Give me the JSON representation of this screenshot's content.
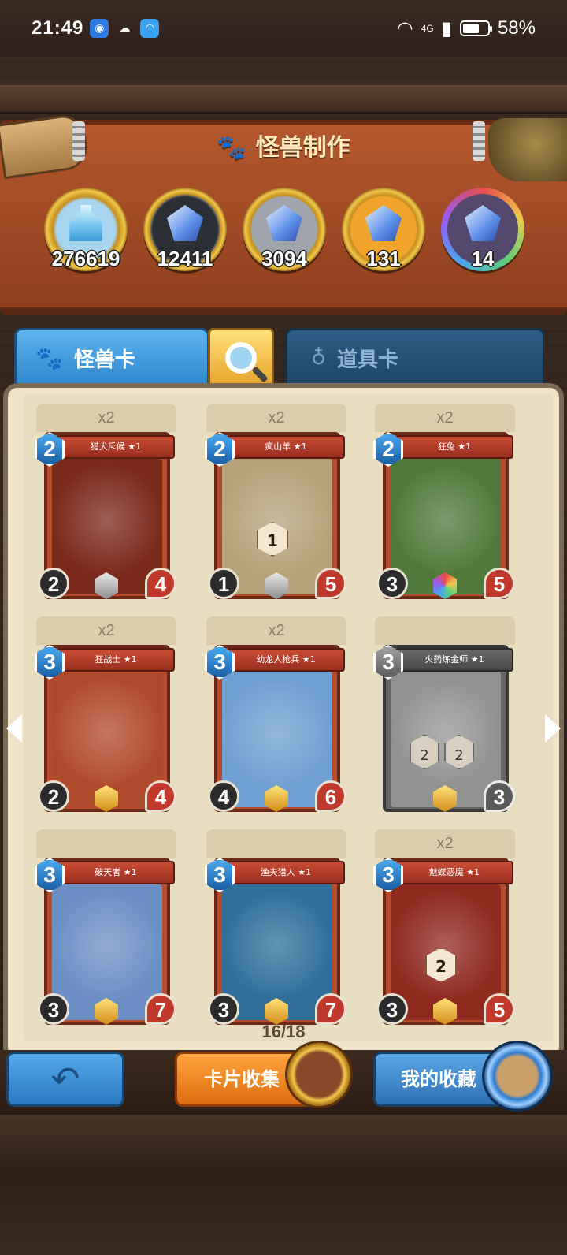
{
  "status_bar": {
    "time": "21:49",
    "network": "4G",
    "battery": "58%"
  },
  "header": {
    "title": "怪兽制作"
  },
  "currencies": [
    {
      "icon": "potion-bottle-icon",
      "count": "276619"
    },
    {
      "icon": "dark-gem-icon",
      "count": "12411"
    },
    {
      "icon": "silver-gem-icon",
      "count": "3094"
    },
    {
      "icon": "gold-gem-icon",
      "count": "131"
    },
    {
      "icon": "rainbow-gem-icon",
      "count": "14"
    }
  ],
  "tabs": {
    "monster": "怪兽卡",
    "item": "道具卡"
  },
  "cards": [
    {
      "dup": "x2",
      "name": "猎犬斥候 ★1",
      "cost": "2",
      "attack": "2",
      "health": "4",
      "gem": "silver",
      "mini": "",
      "art": "#7a2a1a"
    },
    {
      "dup": "x2",
      "name": "疯山羊 ★1",
      "cost": "2",
      "attack": "1",
      "health": "5",
      "gem": "silver",
      "mini": "1",
      "art": "#b7a27a"
    },
    {
      "dup": "x2",
      "name": "狂兔 ★1",
      "cost": "2",
      "attack": "3",
      "health": "5",
      "gem": "rainbow",
      "mini": "",
      "art": "#4f7a3a"
    },
    {
      "dup": "x2",
      "name": "狂战士 ★1",
      "cost": "3",
      "attack": "2",
      "health": "4",
      "gem": "gold",
      "mini": "",
      "art": "#b04a2c"
    },
    {
      "dup": "x2",
      "name": "幼龙人枪兵 ★1",
      "cost": "3",
      "attack": "4",
      "health": "6",
      "gem": "gold",
      "mini": "",
      "art": "#6f9fd0"
    },
    {
      "dup": "",
      "name": "火药炼金师 ★1",
      "cost": "3",
      "attack": "",
      "health": "3",
      "gem": "gold",
      "mini": "",
      "art": "#8a8a8a",
      "gray": true,
      "mini_a": "2",
      "mini_b": "2"
    },
    {
      "dup": "",
      "name": "破天者 ★1",
      "cost": "3",
      "attack": "3",
      "health": "7",
      "gem": "gold",
      "mini": "",
      "art": "#6b8fc4"
    },
    {
      "dup": "",
      "name": "渔夫猎人 ★1",
      "cost": "3",
      "attack": "3",
      "health": "7",
      "gem": "gold",
      "mini": "",
      "art": "#2f6f9a"
    },
    {
      "dup": "x2",
      "name": "魅蝶恶魔 ★1",
      "cost": "3",
      "attack": "3",
      "health": "5",
      "gem": "gold",
      "mini": "2",
      "art": "#8f2a1f"
    }
  ],
  "pager": "16/18",
  "buttons": {
    "collect": "卡片收集",
    "mine": "我的收藏"
  },
  "colors": {
    "header": "#b4582e",
    "tab_active": "#2f86cc",
    "tab_inactive": "#1f4668",
    "collect": "#e06d12",
    "page": "#e9ddbf"
  }
}
